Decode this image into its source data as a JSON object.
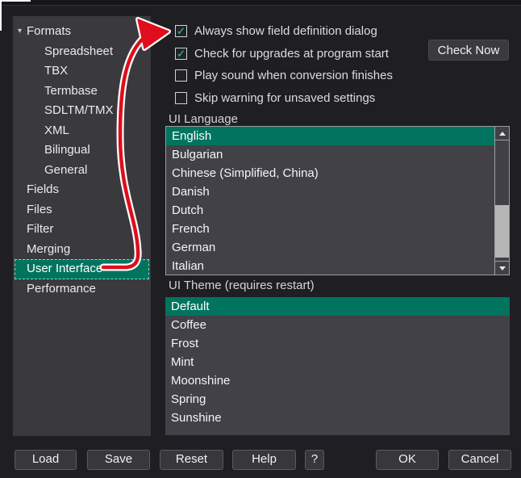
{
  "sidebar": {
    "items": [
      {
        "label": "Formats",
        "level": 0,
        "expander": true,
        "selected": false
      },
      {
        "label": "Spreadsheet",
        "level": 1,
        "expander": false,
        "selected": false
      },
      {
        "label": "TBX",
        "level": 1,
        "expander": false,
        "selected": false
      },
      {
        "label": "Termbase",
        "level": 1,
        "expander": false,
        "selected": false
      },
      {
        "label": "SDLTM/TMX",
        "level": 1,
        "expander": false,
        "selected": false
      },
      {
        "label": "XML",
        "level": 1,
        "expander": false,
        "selected": false
      },
      {
        "label": "Bilingual",
        "level": 1,
        "expander": false,
        "selected": false
      },
      {
        "label": "General",
        "level": 1,
        "expander": false,
        "selected": false
      },
      {
        "label": "Fields",
        "level": 0,
        "expander": false,
        "selected": false
      },
      {
        "label": "Files",
        "level": 0,
        "expander": false,
        "selected": false
      },
      {
        "label": "Filter",
        "level": 0,
        "expander": false,
        "selected": false
      },
      {
        "label": "Merging",
        "level": 0,
        "expander": false,
        "selected": false
      },
      {
        "label": "User Interface",
        "level": 0,
        "expander": false,
        "selected": true
      },
      {
        "label": "Performance",
        "level": 0,
        "expander": false,
        "selected": false
      }
    ]
  },
  "options": {
    "checkboxes": [
      {
        "label": "Always show field definition dialog",
        "checked": true
      },
      {
        "label": "Check for upgrades at program start",
        "checked": true
      },
      {
        "label": "Play sound when conversion finishes",
        "checked": false
      },
      {
        "label": "Skip warning for unsaved settings",
        "checked": false
      }
    ],
    "check_now_label": "Check Now"
  },
  "ui_language": {
    "label": "UI Language",
    "selected": "English",
    "items": [
      "English",
      "Bulgarian",
      "Chinese (Simplified, China)",
      "Danish",
      "Dutch",
      "French",
      "German",
      "Italian"
    ]
  },
  "ui_theme": {
    "label": "UI Theme (requires restart)",
    "selected": "Default",
    "items": [
      "Default",
      "Coffee",
      "Frost",
      "Mint",
      "Moonshine",
      "Spring",
      "Sunshine"
    ]
  },
  "footer": {
    "buttons": [
      "Load",
      "Save",
      "Reset",
      "Help",
      "?",
      "OK",
      "Cancel"
    ]
  },
  "colors": {
    "selection_teal": "#00745e",
    "checkmark_green": "#2aa17c",
    "arrow_red": "#e00d1d",
    "arrow_outline": "#ffffff"
  }
}
